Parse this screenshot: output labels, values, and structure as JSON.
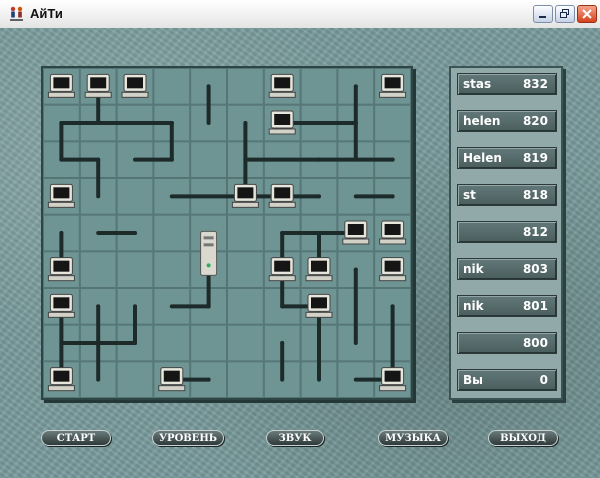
{
  "window": {
    "title": "АйТи",
    "app_icon": "people-network-icon",
    "controls": [
      "minimize-icon",
      "restore-icon",
      "close-icon"
    ]
  },
  "scores": [
    {
      "name": "stas",
      "score": "832"
    },
    {
      "name": "helen",
      "score": "820"
    },
    {
      "name": "Helen",
      "score": "819"
    },
    {
      "name": "st",
      "score": "818"
    },
    {
      "name": "",
      "score": "812"
    },
    {
      "name": "nik",
      "score": "803"
    },
    {
      "name": "nik",
      "score": "801"
    },
    {
      "name": "",
      "score": "800"
    },
    {
      "name": "Вы",
      "score": "0"
    }
  ],
  "menu": {
    "start": "СТАРТ",
    "level": "УРОВЕНЬ",
    "sound": "ЗВУК",
    "music": "МУЗЫКА",
    "exit": "ВЫХОД"
  },
  "board": {
    "columns": 10,
    "rows": 9,
    "server_cell": [
      4,
      5
    ],
    "computers": [
      [
        0,
        0
      ],
      [
        1,
        0
      ],
      [
        2,
        0
      ],
      [
        6,
        0
      ],
      [
        9,
        0
      ],
      [
        6,
        1
      ],
      [
        0,
        3
      ],
      [
        5,
        3
      ],
      [
        6,
        3
      ],
      [
        8,
        4
      ],
      [
        9,
        4
      ],
      [
        0,
        5
      ],
      [
        6,
        5
      ],
      [
        7,
        5
      ],
      [
        9,
        5
      ],
      [
        0,
        6
      ],
      [
        7,
        6
      ],
      [
        0,
        8
      ],
      [
        3,
        8
      ],
      [
        9,
        8
      ]
    ]
  }
}
